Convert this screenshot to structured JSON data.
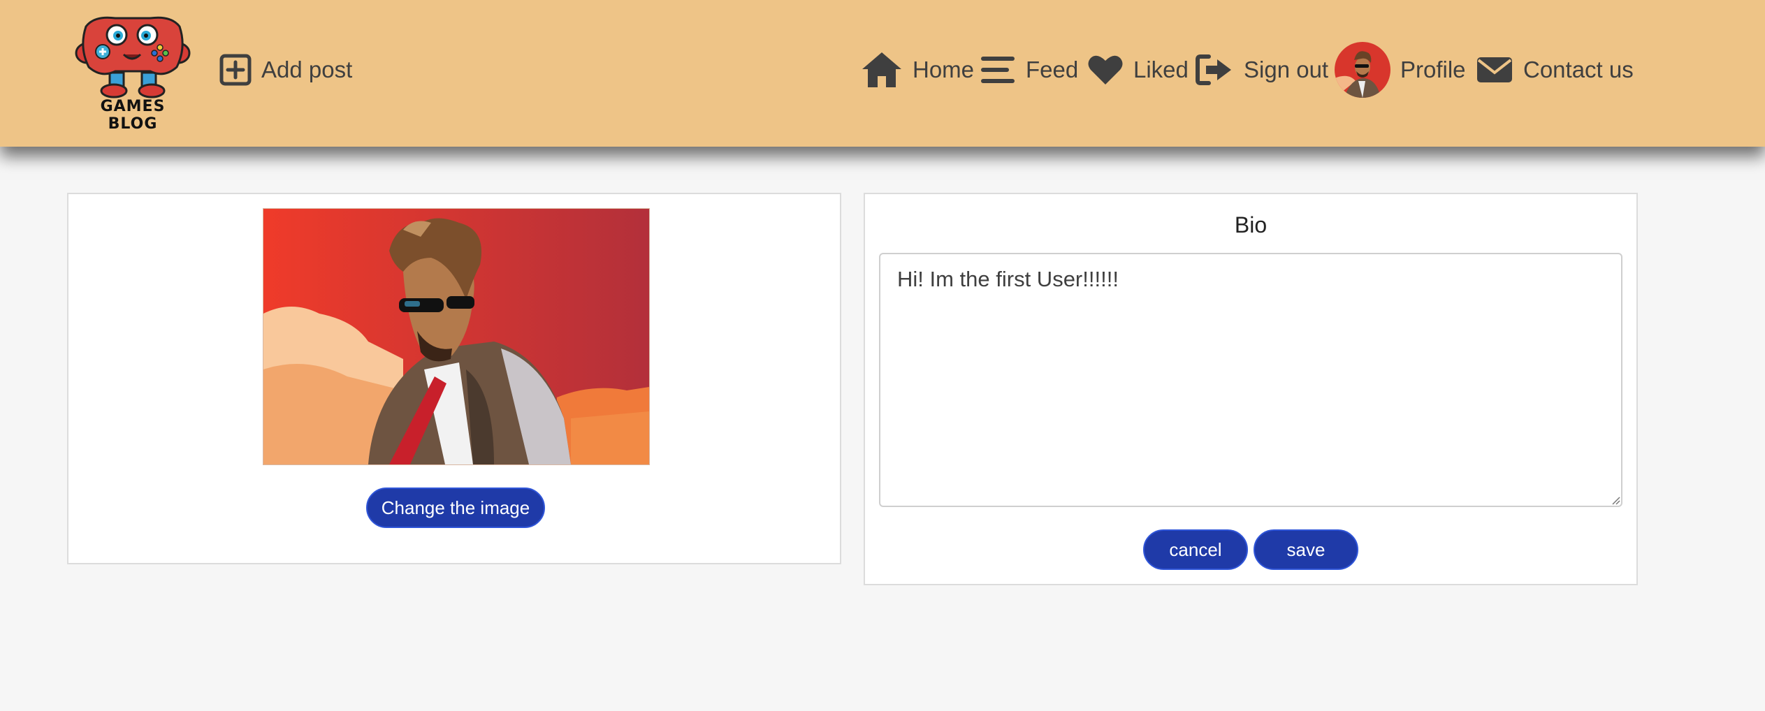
{
  "navbar": {
    "logo_text": "GAMES BLOG",
    "add_post": "Add post",
    "links": {
      "home": "Home",
      "feed": "Feed",
      "liked": "Liked",
      "sign_out": "Sign out",
      "profile": "Profile",
      "contact": "Contact us"
    },
    "icons": {
      "add_post": "plus-square-icon",
      "home": "home-icon",
      "feed": "bars-icon",
      "liked": "heart-icon",
      "sign_out": "sign-out-icon",
      "profile": "avatar",
      "contact": "envelope-icon"
    }
  },
  "profile_card": {
    "change_image_label": "Change the image"
  },
  "bio_card": {
    "title": "Bio",
    "bio_text": "Hi! Im the first User!!!!!!",
    "cancel_label": "cancel",
    "save_label": "save"
  },
  "colors": {
    "navbar_bg": "#eec487",
    "button_bg": "#1f3aa8",
    "text": "#3f3f3f",
    "page_bg": "#f6f6f6"
  }
}
